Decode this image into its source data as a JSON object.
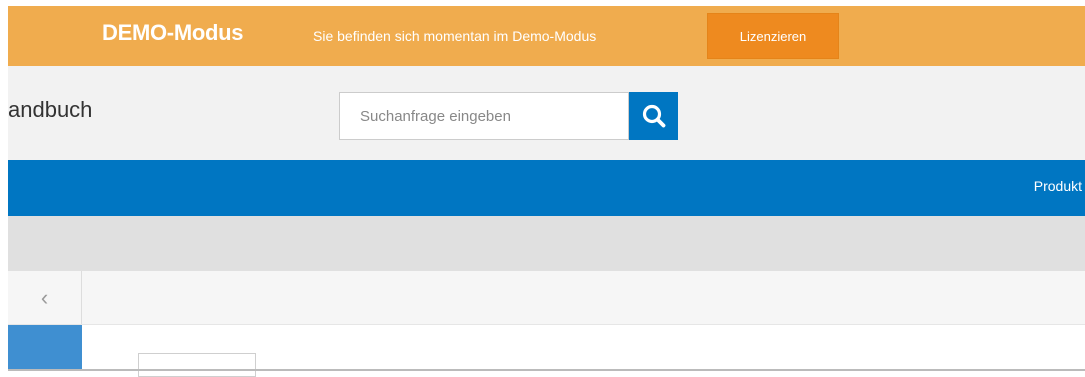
{
  "demo_banner": {
    "title": "DEMO-Modus",
    "message": "Sie befinden sich momentan im Demo-Modus",
    "license_button": "Lizenzieren",
    "color": "#f0ac4e",
    "button_color": "#ee8a1f"
  },
  "header": {
    "title": "andbuch",
    "search": {
      "placeholder": "Suchanfrage eingeben",
      "value": "",
      "button_icon": "search-icon"
    }
  },
  "nav": {
    "color": "#0076c2",
    "items": [
      {
        "label": "Produkt"
      }
    ]
  },
  "toolbar": {
    "back_icon": "chevron-left-icon",
    "back_glyph": "‹"
  }
}
